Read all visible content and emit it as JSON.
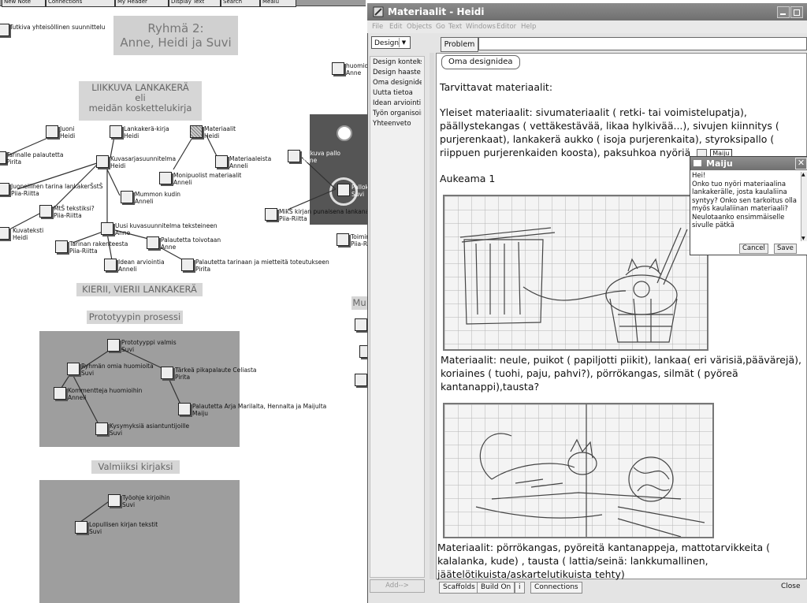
{
  "toolbar": {
    "items": [
      "New Note",
      "Connections",
      "My Header",
      "Display Text",
      "Search",
      "Meaiu"
    ]
  },
  "map": {
    "top_note": "Tutkiva yhteisöllinen suunnittelu",
    "group_title_line1": "Ryhmä 2:",
    "group_title_line2": "Anne, Heidi ja Suvi",
    "heading_liikkuva": "LIIKKUVA LANKAKERÄ\neli\nmeidän koskettelukirja",
    "heading_kierii": "KIERII, VIERII LANKAKERÄ",
    "heading_prototyyppi": "Prototyypin prosessi",
    "heading_valmiiksi": "Valmiiksi kirjaksi",
    "heading_mu": "Mu",
    "nodes": [
      {
        "id": "n1",
        "title": "Juoni",
        "author": "Heidi"
      },
      {
        "id": "n2",
        "title": "Lankakerä-kirja",
        "author": "Heidi"
      },
      {
        "id": "n3",
        "title": "Materiaalit",
        "author": "Heidi"
      },
      {
        "id": "n4",
        "title": "Tarinalle palautetta",
        "author": "Pirita"
      },
      {
        "id": "n5",
        "title": "Kuvasarjasuunnitelma",
        "author": "Heidi"
      },
      {
        "id": "n6",
        "title": "Materiaaleista",
        "author": "Anneli"
      },
      {
        "id": "n7",
        "title": "Monipuolist materiaalit",
        "author": "Anneli"
      },
      {
        "id": "n8",
        "title": "Juonellinen tarina lankakerŠstŠ",
        "author": "Piia-Riitta"
      },
      {
        "id": "n9",
        "title": "Mummon kudin",
        "author": "Anneli"
      },
      {
        "id": "n10",
        "title": "MtŠ tekstiksi?",
        "author": "Piia-Riitta"
      },
      {
        "id": "n11",
        "title": "Kuvateksti",
        "author": "Heidi"
      },
      {
        "id": "n12",
        "title": "Uusi kuvasuunnitelma teksteineen",
        "author": "Anne"
      },
      {
        "id": "n13",
        "title": "Tarinan rakenteesta",
        "author": "Piia-Riitta"
      },
      {
        "id": "n14",
        "title": "Palautetta toivotaan",
        "author": "Anne"
      },
      {
        "id": "n15",
        "title": "Idean arviointia",
        "author": "Anneli"
      },
      {
        "id": "n16",
        "title": "Palautetta tarinaan ja mietteitä toteutukseen",
        "author": "Pirita"
      },
      {
        "id": "n17",
        "title": "huomio",
        "author": "Anne"
      },
      {
        "id": "n18",
        "title": "liikkuva pallo",
        "author": "Anne"
      },
      {
        "id": "n19",
        "title": "Pallok",
        "author": "Suvi"
      },
      {
        "id": "n20",
        "title": "MikŠ kirjan punaisena lankana?",
        "author": "Piia-Riitta"
      },
      {
        "id": "n21",
        "title": "Toimin",
        "author": "Piia-Ri"
      },
      {
        "id": "n22",
        "title": "Prototyyppi valmis",
        "author": "Suvi"
      },
      {
        "id": "n23",
        "title": "Ryhmän omia huomioita",
        "author": "Suvi"
      },
      {
        "id": "n24",
        "title": "Tärkeä pikapalaute Celiasta",
        "author": "Pirita"
      },
      {
        "id": "n25",
        "title": "Kommentteja huomioihin",
        "author": "Anneli"
      },
      {
        "id": "n26",
        "title": "Palautetta Arja Marilalta, Hennalta ja Maijulta",
        "author": "Maiju"
      },
      {
        "id": "n27",
        "title": "Kysymyksiä asiantuntijoille",
        "author": "Suvi"
      },
      {
        "id": "n28",
        "title": "Työohje kirjoihin",
        "author": "Suvi"
      },
      {
        "id": "n29",
        "title": "Lopullisen kirjan tekstit",
        "author": "Suvi"
      }
    ]
  },
  "window": {
    "title": "Materiaalit - Heidi",
    "menu": [
      "File",
      "Edit",
      "Objects",
      "Go",
      "Text",
      "Windows",
      "Editor",
      "Help"
    ],
    "design_select": "Design",
    "scaffolds": [
      "Design kontekst",
      "Design haaste",
      "Oma designidea",
      "Uutta tietoa",
      "Idean arviointi",
      "Työn organisoin",
      "Yhteenveto"
    ],
    "add_button": "Add-->",
    "problem_button": "Problem",
    "scaffold_tag": "Oma designidea",
    "p_tarvittavat": "Tarvittavat materiaalit:",
    "p_yleiset": "Yleiset materiaalit: sivumateriaalit ( retki- tai voimistelupatja), päällystekangas ( vettäkestävää, likaa hylkivää...), sivujen kiinnitys ( purjerenkaat), lankakerä aukko ( isoja purjerenkaita), styroksipallo ( riippuen purjerenkaiden koosta), paksuhkoa nyöriä",
    "inline_note_label": "Maiju",
    "p_aukeama": "Aukeama 1",
    "p_materiaalit1": "Materiaalit: neule, puikot ( papiljotti piikit), lankaa( eri värisiä,päävärejä), koriaines ( tuohi, paju, pahvi?), pörrökangas, silmät ( pyöreä kantanappi),tausta?",
    "p_materiaalit2": "Materiaalit: pörrökangas, pyöreitä kantanappeja, mattotarvikkeita ( kalalanka, kude) , tausta ( lattia/seinä: lankkumallinen, jäätelötikuista/askartelutikuista tehty)",
    "tabs": [
      "Scaffolds",
      "Build On",
      "i",
      "Connections"
    ],
    "close_label": "Close"
  },
  "popup": {
    "title": "Maiju",
    "text": "Hei!\nOnko tuo nyöri materiaalina lankakerälle, josta kaulaliina syntyy? Onko sen tarkoitus olla myös kaulaliinan materiaali? Neulotaanko ensimmäiselle sivulle pätkä",
    "cancel": "Cancel",
    "save": "Save"
  }
}
